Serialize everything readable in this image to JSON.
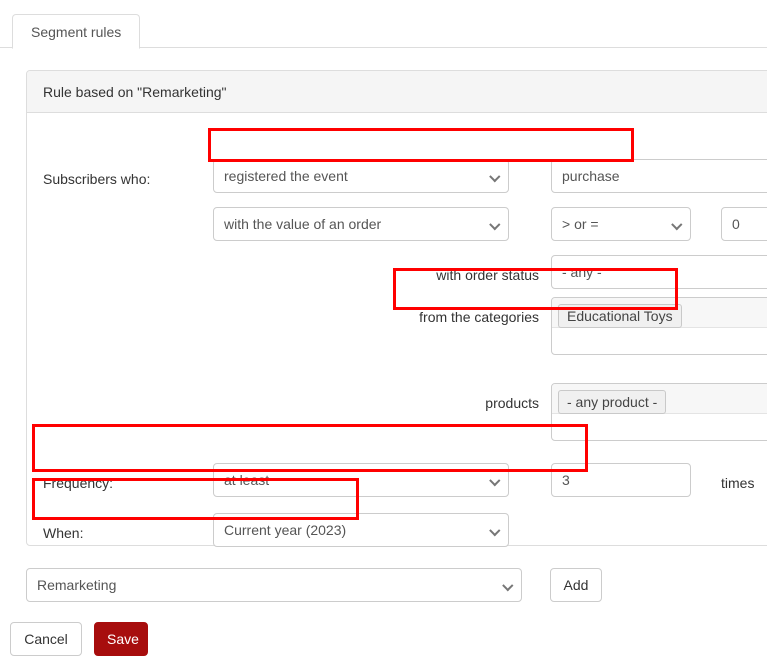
{
  "tab": {
    "label": "Segment rules"
  },
  "panel": {
    "heading": "Rule based on \"Remarketing\""
  },
  "rows": {
    "subscribers": {
      "label": "Subscribers who:",
      "action_select": "registered the event",
      "event_value": "purchase"
    },
    "order_value": {
      "condition_select": "with the value of an order",
      "operator_select": "> or =",
      "amount": "0"
    },
    "order_status": {
      "label": "with order status",
      "value": "- any -"
    },
    "categories": {
      "label": "from the categories",
      "tags": [
        "Educational Toys"
      ]
    },
    "products": {
      "label": "products",
      "tags": [
        "- any product -"
      ]
    },
    "frequency": {
      "label": "Frequency:",
      "operator_select": "at least",
      "count": "3",
      "unit": "times"
    },
    "when": {
      "label": "When:",
      "value": "Current year (2023)"
    }
  },
  "footer": {
    "rule_select": "Remarketing",
    "add_label": "Add",
    "cancel_label": "Cancel",
    "save_label": "Save"
  },
  "colors": {
    "highlight": "#ff0000",
    "save_bg": "#a70d0d",
    "panel_heading_bg": "#f5f5f5",
    "border": "#cccccc"
  }
}
